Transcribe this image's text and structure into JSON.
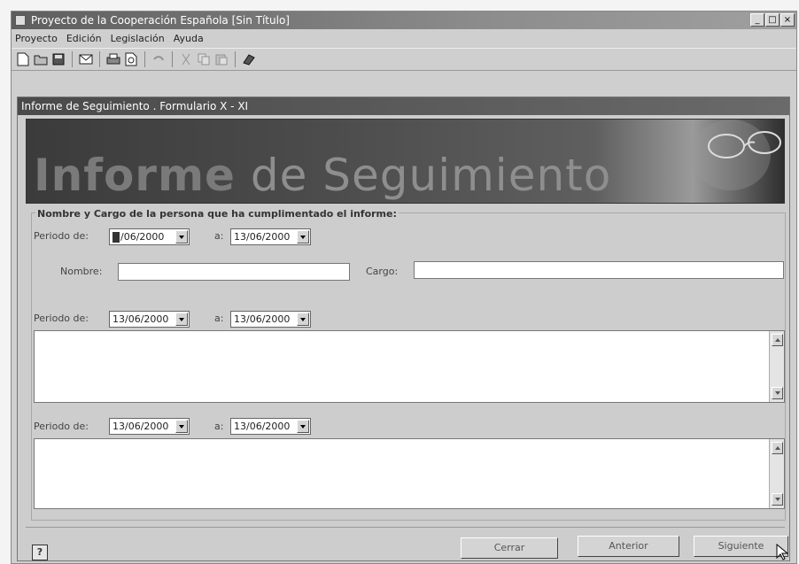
{
  "window": {
    "title": "Proyecto de la Cooperación Española  [Sin Título]",
    "controls": [
      "_",
      "□",
      "×"
    ]
  },
  "menu": [
    "Proyecto",
    "Edición",
    "Legislación",
    "Ayuda"
  ],
  "toolbar": {
    "icons": [
      "new-file-icon",
      "open-folder-icon",
      "save-icon",
      "mail-icon",
      "print-icon",
      "print-preview-icon",
      "undo-icon",
      "cut-icon",
      "copy-icon",
      "paste-icon",
      "book-icon"
    ]
  },
  "form": {
    "title": "Informe de Seguimiento  .  Formulario X - XI",
    "banner": {
      "bold": "Informe",
      "light": " de Seguimiento"
    },
    "section_label": "Nombre y Cargo de la persona que ha cumplimentado el informe:",
    "periodo_label": "Periodo de:",
    "a_label": "a:",
    "nombre_label": "Nombre:",
    "cargo_label": "Cargo:",
    "nombre_value": "",
    "cargo_value": "",
    "periods": [
      {
        "from": "13/06/2000",
        "to": "13/06/2000"
      },
      {
        "from": "13/06/2000",
        "to": "13/06/2000"
      },
      {
        "from": "13/06/2000",
        "to": "13/06/2000"
      }
    ],
    "first_from_rest": "/06/2000",
    "buttons": {
      "close": "Cerrar",
      "previous": "Anterior",
      "next": "Siguiente"
    },
    "help": "?"
  }
}
